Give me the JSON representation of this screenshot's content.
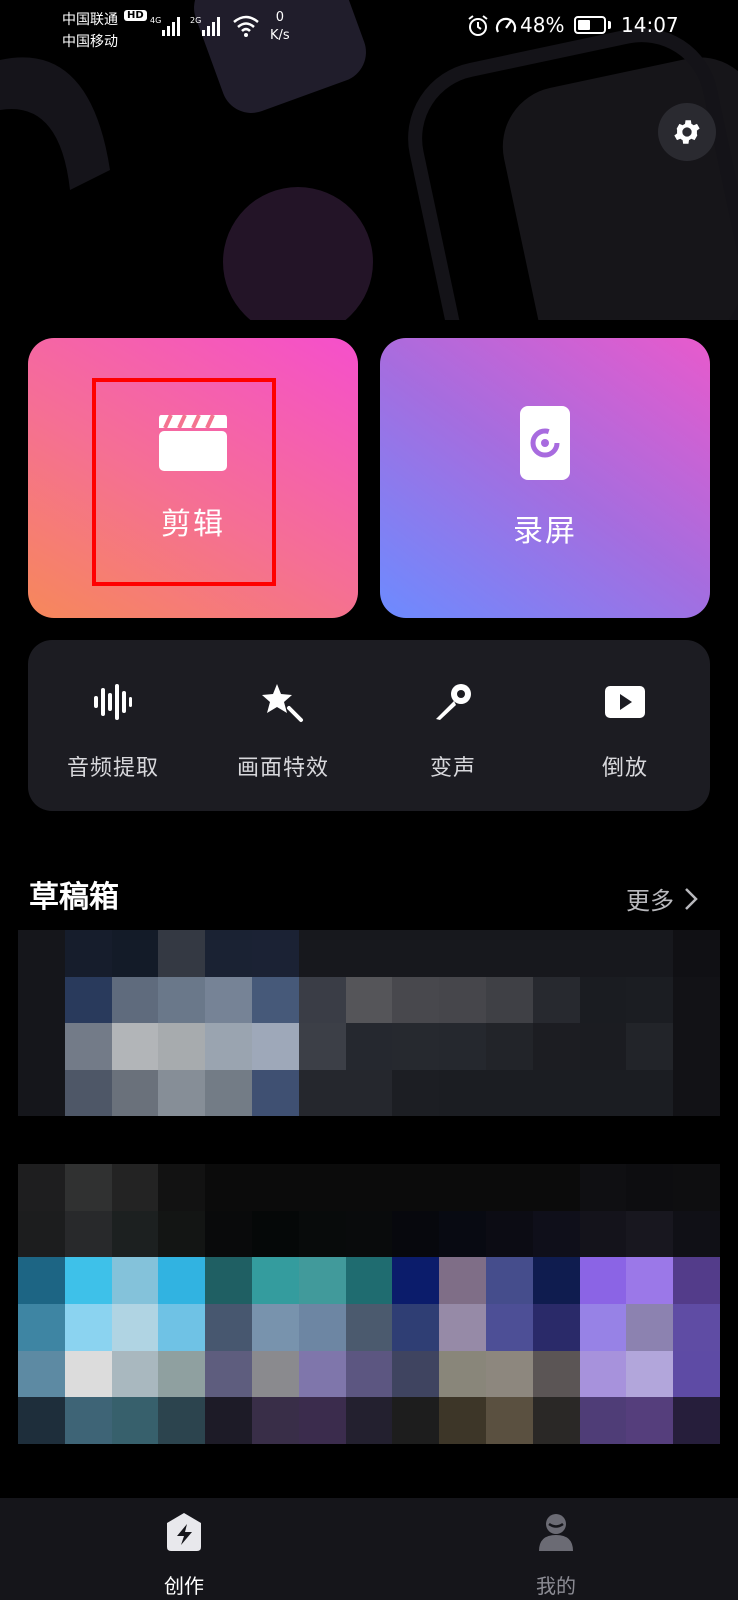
{
  "status_bar": {
    "carrier_1": "中国联通",
    "carrier_2": "中国移动",
    "hd_badge": "HD",
    "signal_1_label": "4G",
    "signal_2_label": "2G",
    "net_speed_value": "0",
    "net_speed_unit": "K/s",
    "battery_percent": "48%",
    "battery_level": 0.48,
    "time": "14:07"
  },
  "header": {
    "settings_icon": "gear-icon"
  },
  "main_cards": [
    {
      "label": "剪辑",
      "icon": "clapperboard-icon",
      "highlighted": true
    },
    {
      "label": "录屏",
      "icon": "screen-record-icon",
      "highlighted": false
    }
  ],
  "tools": [
    {
      "label": "音频提取",
      "icon": "audio-waveform-icon"
    },
    {
      "label": "画面特效",
      "icon": "magic-star-icon"
    },
    {
      "label": "变声",
      "icon": "microphone-icon"
    },
    {
      "label": "倒放",
      "icon": "play-reverse-icon"
    }
  ],
  "drafts": {
    "title": "草稿箱",
    "more_label": "更多",
    "items": [
      {
        "thumbnail_pixels": [
          [
            "#15161b",
            "#161d2c",
            "#131b28",
            "#343943",
            "#1a2233",
            "#1b2234",
            "#17181d",
            "#17181d",
            "#17181d",
            "#17181d",
            "#17181d",
            "#17181d",
            "#17181d",
            "#17181d",
            "#101014"
          ],
          [
            "#15161b",
            "#293a5c",
            "#5f6b7d",
            "#6a788a",
            "#768396",
            "#465979",
            "#3a3d46",
            "#555559",
            "#48484d",
            "#46464b",
            "#3f4045",
            "#27292f",
            "#1a1c21",
            "#1b1d22",
            "#121216"
          ],
          [
            "#15161b",
            "#737b88",
            "#b2b5b8",
            "#a7abae",
            "#9aa4b0",
            "#9ea8b9",
            "#3c3f47",
            "#25282f",
            "#26292f",
            "#25282e",
            "#222429",
            "#1c1d22",
            "#1b1c21",
            "#222429",
            "#121216"
          ],
          [
            "#15161b",
            "#4e5767",
            "#6a717b",
            "#868e97",
            "#737c86",
            "#3f5072",
            "#25272d",
            "#25272d",
            "#1c1e23",
            "#1b1d22",
            "#1b1d22",
            "#1b1d22",
            "#1b1d22",
            "#1b1d22",
            "#121216"
          ]
        ]
      },
      {
        "thumbnail_pixels": [
          [
            "#1e1e1f",
            "#303131",
            "#232323",
            "#121212",
            "#0b0b0b",
            "#0b0b0b",
            "#0b0b0b",
            "#0b0b0b",
            "#0b0b0b",
            "#0b0b0b",
            "#0b0b0b",
            "#0b0b0b",
            "#0f0f12",
            "#0d0d10",
            "#0e0e10"
          ],
          [
            "#1c1d1e",
            "#28292b",
            "#1c2020",
            "#131514",
            "#090a0b",
            "#050808",
            "#080b0b",
            "#090b0c",
            "#07080d",
            "#080a12",
            "#0c0c14",
            "#0f0f1a",
            "#14131b",
            "#18171f",
            "#101016"
          ],
          [
            "#1d6584",
            "#3ec1e9",
            "#84c2da",
            "#31b3e1",
            "#1f5f63",
            "#349c9e",
            "#419a9b",
            "#1f6c70",
            "#0b1c6b",
            "#7f6e87",
            "#454d8c",
            "#0f1c4f",
            "#8b64e5",
            "#9b78e8",
            "#533c8a"
          ],
          [
            "#3e85a3",
            "#8bd3f0",
            "#b0d4e3",
            "#6fc2e5",
            "#47576f",
            "#7893ad",
            "#6d86a3",
            "#4b5a6e",
            "#2f3e74",
            "#968aa7",
            "#4d4f96",
            "#2a2a69",
            "#9782e6",
            "#8c82b0",
            "#5f4ca4"
          ],
          [
            "#5d8aa3",
            "#dcdcdc",
            "#a9b8bf",
            "#8fa0a0",
            "#5e5d7e",
            "#8a8a8e",
            "#7f76ab",
            "#5c5681",
            "#3f4460",
            "#89867a",
            "#8d877e",
            "#5b5555",
            "#a792dc",
            "#b2a6db",
            "#5e4ba5"
          ],
          [
            "#1e2e3b",
            "#3e6476",
            "#37606c",
            "#2c444e",
            "#1d1b27",
            "#392e48",
            "#3b2c4d",
            "#23202f",
            "#1d1d1d",
            "#3d3628",
            "#5a5040",
            "#2a2826",
            "#4f3d77",
            "#553e7c",
            "#261e3b"
          ]
        ]
      }
    ]
  },
  "bottom_nav": [
    {
      "label": "创作",
      "icon": "create-lightning-icon",
      "active": true
    },
    {
      "label": "我的",
      "icon": "profile-icon",
      "active": false
    }
  ]
}
